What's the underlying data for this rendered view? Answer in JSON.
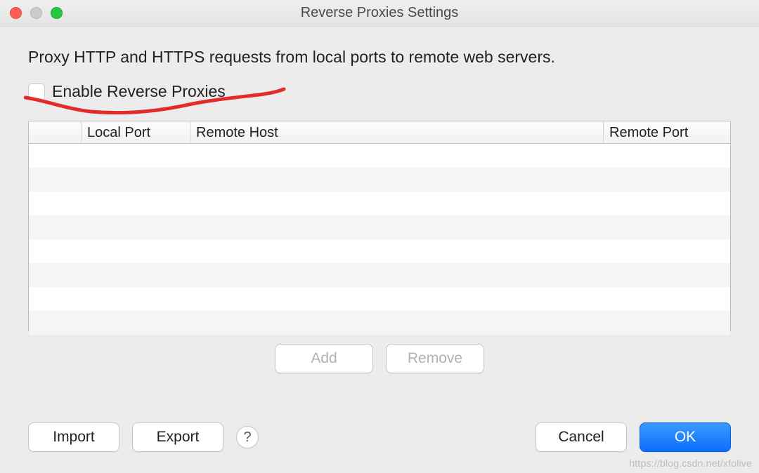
{
  "window": {
    "title": "Reverse Proxies Settings"
  },
  "description": "Proxy HTTP and HTTPS requests from local ports to remote web servers.",
  "checkbox": {
    "label": "Enable Reverse Proxies",
    "checked": false
  },
  "table": {
    "columns": {
      "check": "",
      "local_port": "Local Port",
      "remote_host": "Remote Host",
      "remote_port": "Remote Port"
    },
    "rows": []
  },
  "buttons": {
    "add": "Add",
    "remove": "Remove",
    "import": "Import",
    "export": "Export",
    "help": "?",
    "cancel": "Cancel",
    "ok": "OK"
  },
  "watermark": "https://blog.csdn.net/xfolive",
  "annotation_color": "#e22c2c"
}
